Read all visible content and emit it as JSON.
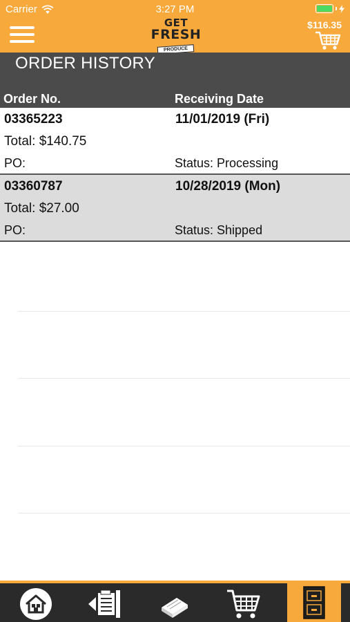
{
  "status_bar": {
    "carrier": "Carrier",
    "time": "3:27 PM"
  },
  "header": {
    "logo_line1": "GET",
    "logo_line2": "FRESH",
    "logo_tag": "PRODUCE",
    "cart_total": "$116.35"
  },
  "page": {
    "title": "ORDER HISTORY",
    "col_order": "Order No.",
    "col_date": "Receiving Date"
  },
  "orders": [
    {
      "number": "03365223",
      "date": "11/01/2019 (Fri)",
      "total": "Total: $140.75",
      "po": "PO:",
      "status": "Status: Processing"
    },
    {
      "number": "03360787",
      "date": "10/28/2019 (Mon)",
      "total": "Total: $27.00",
      "po": "PO:",
      "status": "Status: Shipped"
    }
  ],
  "tabs": [
    {
      "icon": "home-icon"
    },
    {
      "icon": "order-list-icon"
    },
    {
      "icon": "catalog-book-icon"
    },
    {
      "icon": "cart-icon"
    },
    {
      "icon": "order-history-icon",
      "active": true
    }
  ],
  "colors": {
    "brand_orange": "#f7a93b",
    "title_bar": "#4b4b4b",
    "tab_bar": "#2a2a2a"
  }
}
